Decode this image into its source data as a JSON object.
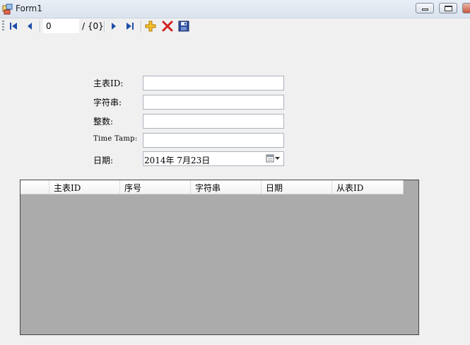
{
  "window": {
    "title": "Form1",
    "icon": "form-app-icon",
    "controls": [
      "minimize-icon",
      "maximize-icon",
      "close-icon"
    ]
  },
  "navigator": {
    "position_value": "0",
    "count_label": "/ {0}",
    "icons": [
      "move-first-icon",
      "move-previous-icon",
      "move-next-icon",
      "move-last-icon",
      "add-new-icon",
      "delete-icon",
      "save-icon"
    ],
    "colors": {
      "nav": "#1f4fa8",
      "add": "#e8a20c",
      "delete": "#d22222",
      "save": "#2c4a9a"
    }
  },
  "form": {
    "fields": [
      {
        "label": "主表ID:",
        "value": ""
      },
      {
        "label": "字符串:",
        "value": ""
      },
      {
        "label": "整数:",
        "value": ""
      },
      {
        "label": "Time Tamp:",
        "value": ""
      }
    ],
    "date": {
      "label": "日期:",
      "value": "2014年  7月23日",
      "icon": "calendar-dropdown-icon"
    }
  },
  "grid": {
    "columns": [
      "主表ID",
      "序号",
      "字符串",
      "日期",
      "从表ID"
    ],
    "rows": [],
    "background": "#ababab"
  }
}
